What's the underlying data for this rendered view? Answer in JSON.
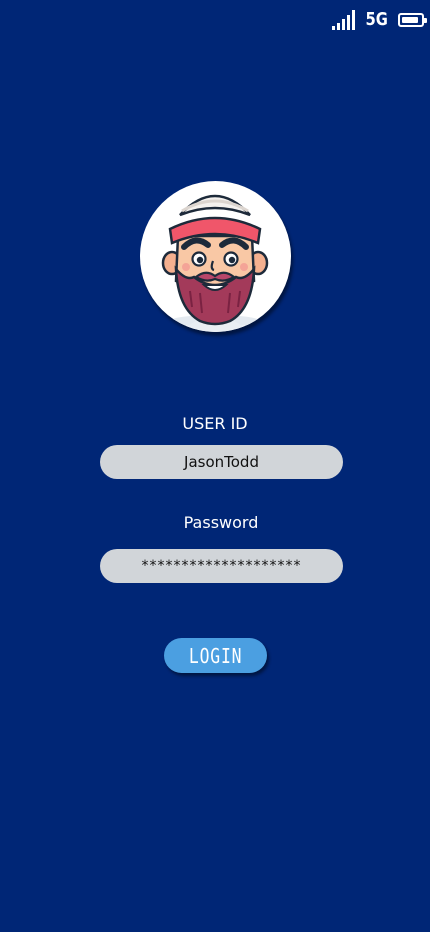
{
  "status_bar": {
    "network": "5G",
    "signal_bars": 5,
    "battery_level": 0.9
  },
  "avatar": {
    "description_icon": "bearded-man-avatar"
  },
  "form": {
    "user_id_label": "USER ID",
    "user_id_value": "JasonTodd",
    "password_label": "Password",
    "password_value": "********************",
    "login_label": "LOGIN"
  },
  "colors": {
    "background": "#002676",
    "input_background": "#d1d5d9",
    "button_background": "#4b9fe1",
    "text": "#ffffff"
  }
}
